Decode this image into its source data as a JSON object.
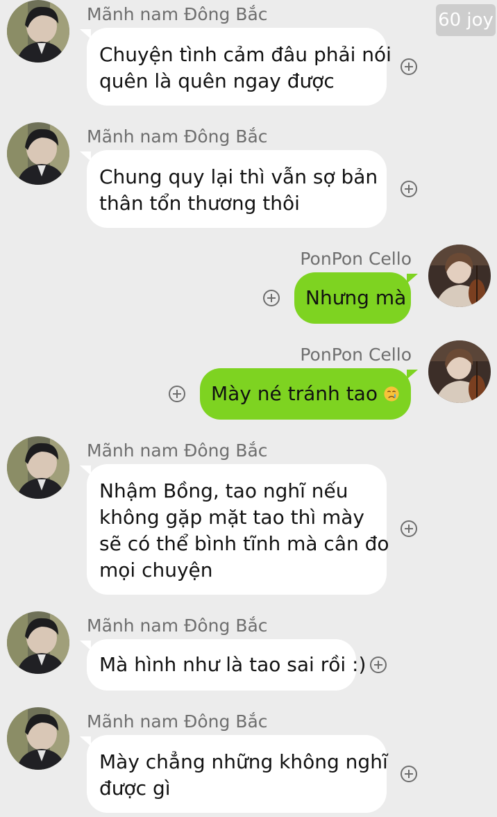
{
  "watermark": "60 joy",
  "messages": [
    {
      "sender": "Mãnh nam Đông Bắc",
      "side": "left",
      "lines": [
        "Chuyện tình cảm đâu phải nói",
        "quên là quên ngay được"
      ]
    },
    {
      "sender": "Mãnh nam Đông Bắc",
      "side": "left",
      "lines": [
        "Chung quy lại thì vẫn sợ bản",
        "thân tổn thương thôi"
      ]
    },
    {
      "sender": "PonPon Cello",
      "side": "right",
      "lines": [
        "Nhưng mà"
      ]
    },
    {
      "sender": "PonPon Cello",
      "side": "right",
      "lines": [
        "Mày né tránh tao"
      ],
      "emoji": "crying-face-emoji"
    },
    {
      "sender": "Mãnh nam Đông Bắc",
      "side": "left",
      "lines": [
        "Nhậm Bồng, tao nghĩ nếu",
        "không gặp mặt tao thì mày",
        "sẽ có thể bình tĩnh mà cân đo",
        "mọi chuyện"
      ]
    },
    {
      "sender": "Mãnh nam Đông Bắc",
      "side": "left",
      "lines": [
        "Mà hình như là tao sai rồi :)"
      ]
    },
    {
      "sender": "Mãnh nam Đông Bắc",
      "side": "left",
      "lines": [
        "Mày chẳng những không nghĩ",
        "được gì"
      ]
    }
  ],
  "colors": {
    "background": "#ececec",
    "bubble_left": "#ffffff",
    "bubble_right": "#7ed321",
    "sender_name": "#6e6e6e"
  },
  "icons": {
    "left_avatar": "avatar-dark-hair-man",
    "right_avatar": "avatar-cello-player",
    "action": "plus-circle-icon"
  }
}
